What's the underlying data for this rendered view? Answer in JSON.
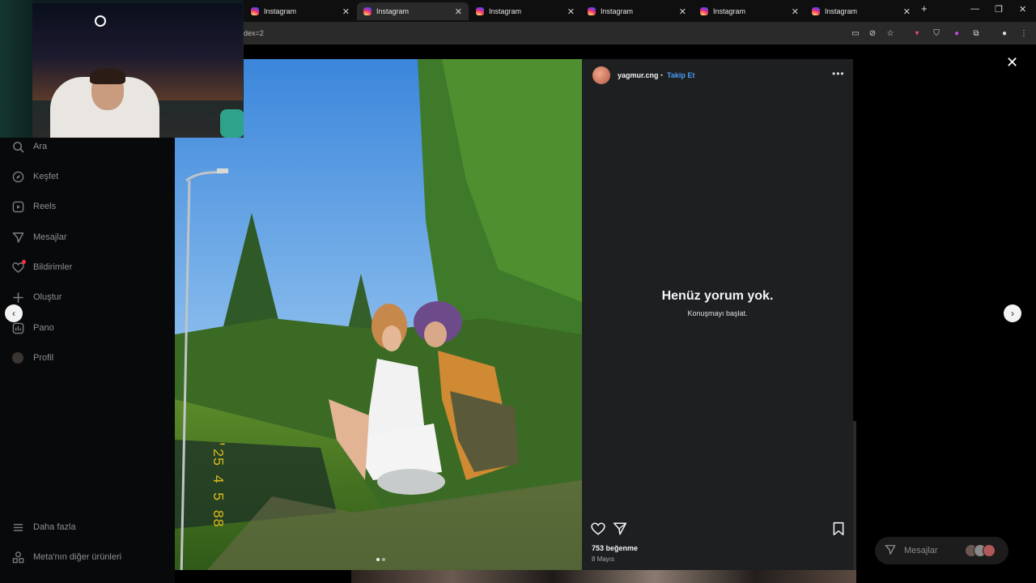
{
  "browser": {
    "tabs": [
      {
        "label": "Instagram",
        "active": false
      },
      {
        "label": "Instagram",
        "active": true
      },
      {
        "label": "Instagram",
        "active": false
      },
      {
        "label": "Instagram",
        "active": false
      },
      {
        "label": "Instagram",
        "active": false
      },
      {
        "label": "Instagram",
        "active": false
      }
    ],
    "url_fragment": "dex=2",
    "new_tab_symbol": "+"
  },
  "sidebar": {
    "items": [
      {
        "label": "Ara",
        "icon": "search-icon"
      },
      {
        "label": "Keşfet",
        "icon": "compass-icon"
      },
      {
        "label": "Reels",
        "icon": "reels-icon"
      },
      {
        "label": "Mesajlar",
        "icon": "send-icon"
      },
      {
        "label": "Bildirimler",
        "icon": "heart-icon"
      },
      {
        "label": "Oluştur",
        "icon": "plus-icon"
      },
      {
        "label": "Pano",
        "icon": "chart-icon"
      },
      {
        "label": "Profil",
        "icon": "avatar-icon"
      }
    ],
    "bottom": [
      {
        "label": "Daha fazla",
        "icon": "menu-icon"
      },
      {
        "label": "Meta'nın diğer ürünleri",
        "icon": "grid-icon"
      }
    ]
  },
  "post": {
    "username": "yagmur.cng",
    "separator": "•",
    "follow_label": "Takip Et",
    "empty_title": "Henüz yorum yok.",
    "empty_subtitle": "Konuşmayı başlat.",
    "likes": "753 beğenme",
    "date": "8 Mayıs",
    "photo_timestamp": "'25 4 5 88"
  },
  "messages_pill": {
    "label": "Mesajlar"
  },
  "colors": {
    "accent_follow": "#4a9cf5",
    "panel_bg": "#1e1f21"
  }
}
